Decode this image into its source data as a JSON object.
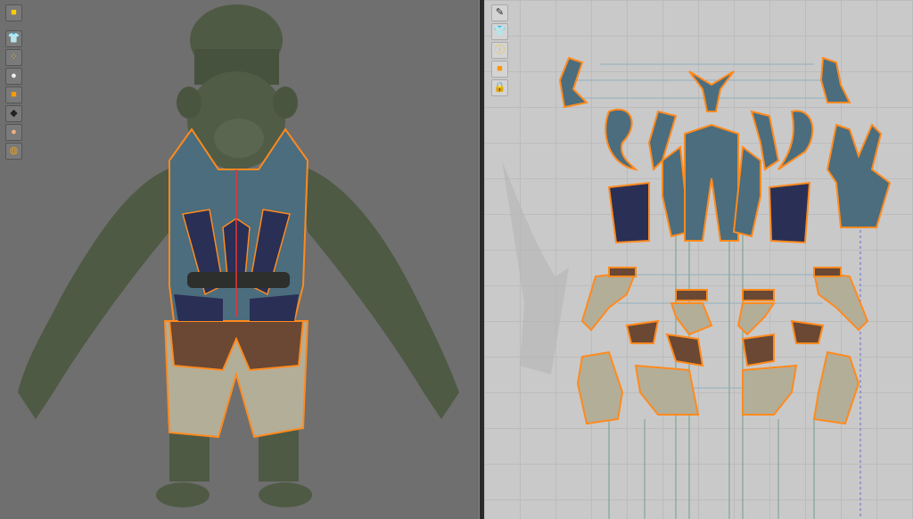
{
  "colors": {
    "skin": "#4e5a44",
    "vest": "#4b6d7d",
    "vest_dark": "#2a2f55",
    "pants": "#b3ae98",
    "brown": "#6a4833",
    "seam": "#ff8a1e",
    "outline": "#8fb8d8",
    "viewport3d_bg": "#6f6f6f",
    "viewport2d_bg": "#c9c9c9"
  },
  "toolbar3d": {
    "icons": [
      "avatar-cube-icon",
      "garment-shirt-icon",
      "points-icon",
      "avatar-person-icon",
      "texture-icon",
      "shading-icon",
      "skin-icon",
      "wireframe-globe-icon"
    ]
  },
  "toolbar2d": {
    "icons": [
      "pen-tool-icon",
      "garment-view-icon",
      "info-icon",
      "texture-icon",
      "lock-garment-icon"
    ]
  }
}
